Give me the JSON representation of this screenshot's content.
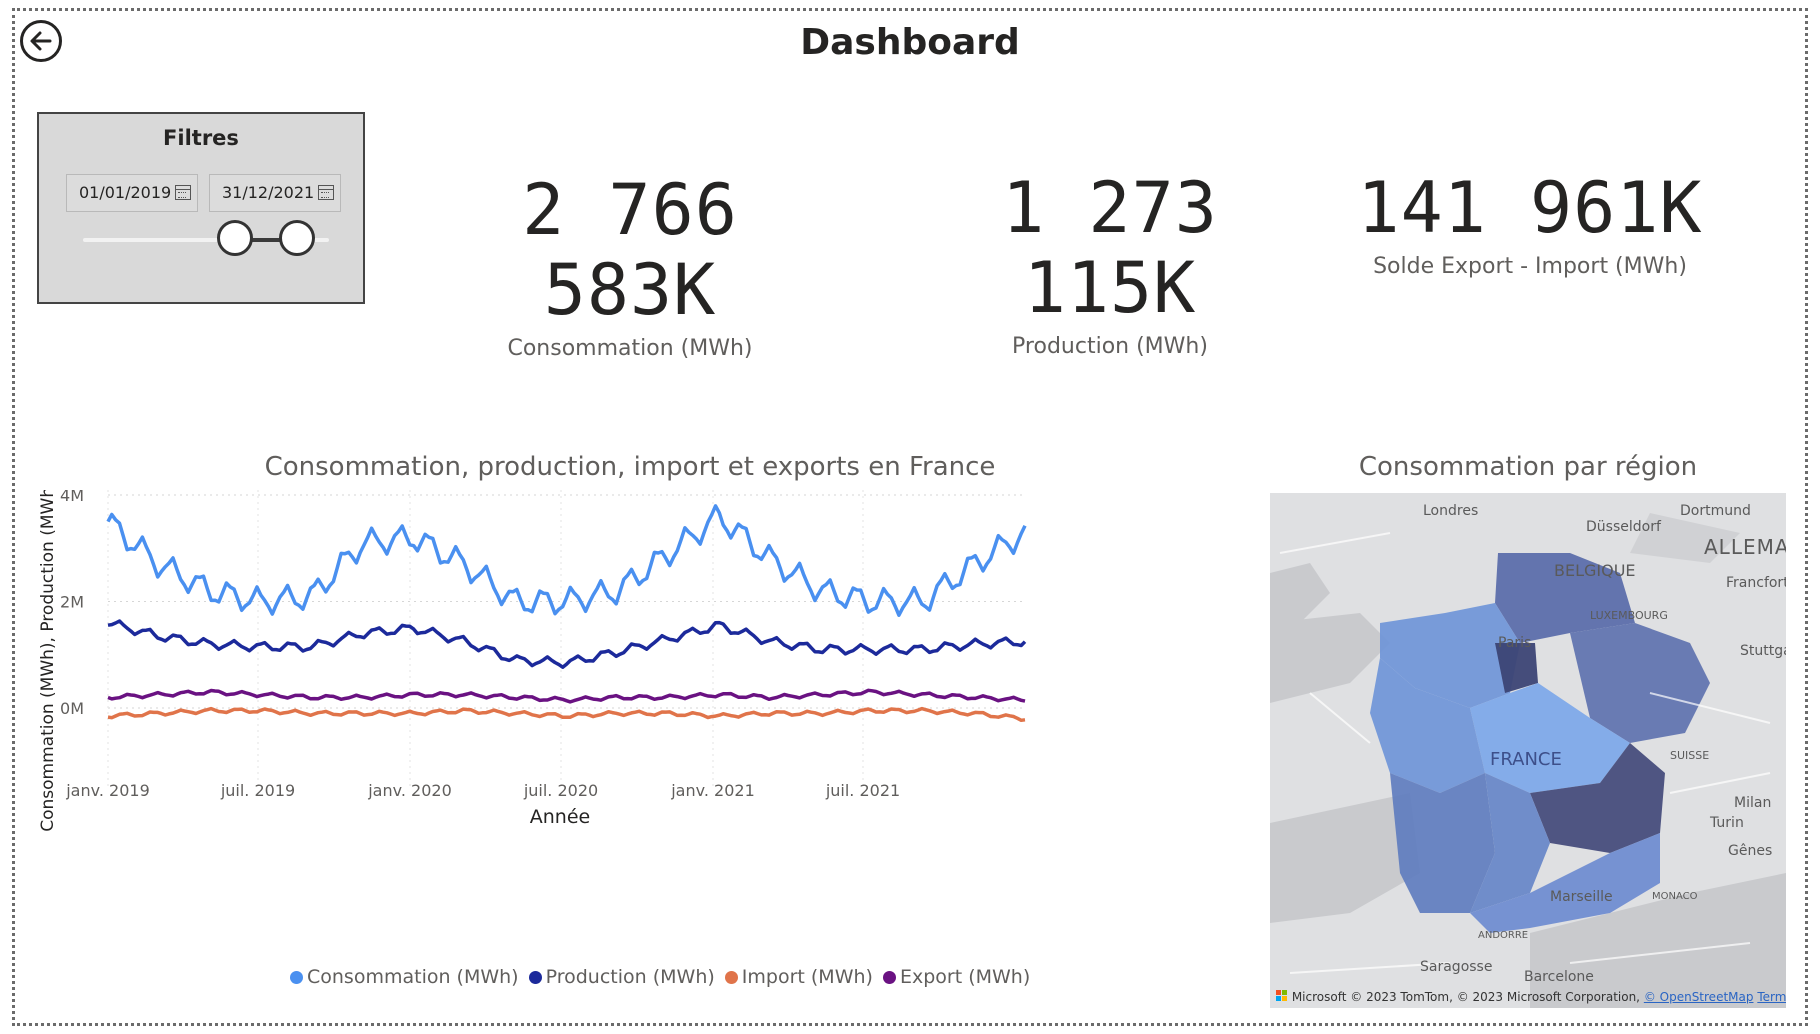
{
  "page": {
    "title": "Dashboard"
  },
  "filters": {
    "title": "Filtres",
    "start_date": "01/01/2019",
    "end_date": "31/12/2021",
    "range": {
      "start_fraction": 0.73,
      "end_fraction": 0.98
    }
  },
  "kpis": [
    {
      "value": "2 766 583K",
      "label": "Consommation (MWh)"
    },
    {
      "value": "1 273 115K",
      "label": "Production (MWh)"
    },
    {
      "value": "141 961K",
      "label": "Solde Export - Import (MWh)"
    }
  ],
  "line_chart": {
    "title": "Consommation, production, import et exports en France",
    "ylabel": "Consommation (MWh), Production (MWh), I...",
    "xlabel": "Année",
    "y_ticks": [
      "4M",
      "2M",
      "0M"
    ],
    "x_ticks": [
      "janv. 2019",
      "juil. 2019",
      "janv. 2020",
      "juil. 2020",
      "janv. 2021",
      "juil. 2021"
    ],
    "legend": [
      "Consommation (MWh)",
      "Production (MWh)",
      "Import (MWh)",
      "Export (MWh)"
    ]
  },
  "map": {
    "title": "Consommation par région",
    "labels": [
      "Londres",
      "Dortmund",
      "Düsseldorf",
      "ALLEMA",
      "BELGIQUE",
      "Francfort",
      "LUXEMBOURG",
      "Paris",
      "Stuttga",
      "FRANCE",
      "SUISSE",
      "Milan",
      "Turin",
      "Gênes",
      "MONACO",
      "Marseille",
      "ANDORRE",
      "Saragosse",
      "Barcelone"
    ],
    "attribution": "© 2023 TomTom, © 2023 Microsoft Corporation,",
    "attribution_link": "© OpenStreetMap",
    "terms": "Terms",
    "brand": "Microsoft"
  },
  "chart_data": {
    "type": "line",
    "title": "Consommation, production, import et exports en France",
    "xlabel": "Année",
    "ylabel": "Consommation (MWh), Production (MWh), I...",
    "ylim": [
      -1000000,
      4000000
    ],
    "x": [
      "2019-01",
      "2019-03",
      "2019-05",
      "2019-07",
      "2019-09",
      "2019-11",
      "2020-01",
      "2020-03",
      "2020-05",
      "2020-07",
      "2020-09",
      "2020-11",
      "2021-01",
      "2021-03",
      "2021-05",
      "2021-07",
      "2021-09",
      "2021-11",
      "2021-12"
    ],
    "series": [
      {
        "name": "Consommation (MWh)",
        "color": "#4a90f0",
        "values": [
          3500000,
          2700000,
          2200000,
          2000000,
          2100000,
          3100000,
          3200000,
          2700000,
          2000000,
          2000000,
          2200000,
          2900000,
          3600000,
          2800000,
          2200000,
          2000000,
          2000000,
          2700000,
          3300000
        ]
      },
      {
        "name": "Production (MWh)",
        "color": "#1c2a9b",
        "values": [
          1600000,
          1350000,
          1200000,
          1150000,
          1150000,
          1400000,
          1500000,
          1250000,
          900000,
          850000,
          1050000,
          1300000,
          1550000,
          1250000,
          1100000,
          1100000,
          1100000,
          1200000,
          1250000
        ]
      },
      {
        "name": "Import (MWh)",
        "color": "#e0744a",
        "values": [
          -150000,
          -100000,
          -50000,
          -50000,
          -100000,
          -100000,
          -100000,
          -50000,
          -100000,
          -150000,
          -100000,
          -100000,
          -150000,
          -100000,
          -100000,
          -50000,
          -50000,
          -100000,
          -200000
        ]
      },
      {
        "name": "Export (MWh)",
        "color": "#6a1282",
        "values": [
          200000,
          250000,
          300000,
          250000,
          200000,
          200000,
          250000,
          250000,
          200000,
          150000,
          200000,
          200000,
          250000,
          200000,
          250000,
          300000,
          250000,
          200000,
          150000
        ]
      }
    ]
  }
}
